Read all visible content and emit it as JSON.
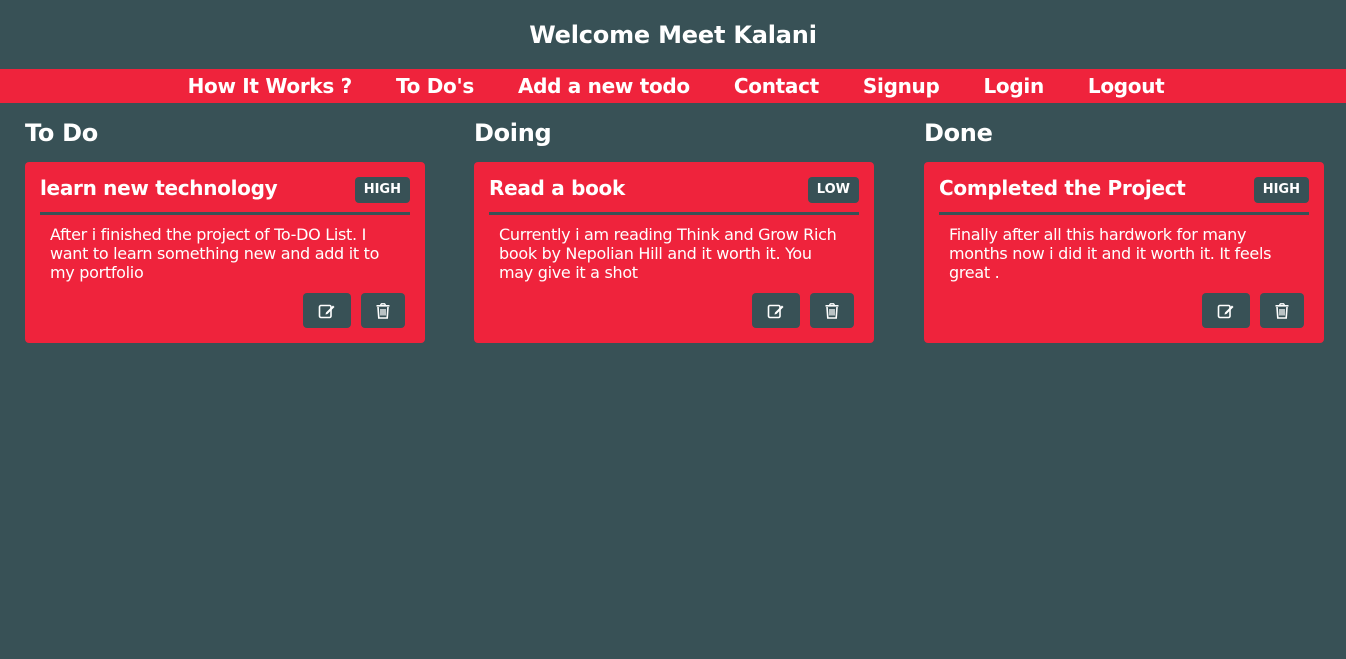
{
  "header": {
    "title": "Welcome Meet Kalani"
  },
  "nav": {
    "items": [
      "How It Works ?",
      "To Do's",
      "Add a new todo",
      "Contact",
      "Signup",
      "Login",
      "Logout"
    ]
  },
  "columns": [
    {
      "title": "To Do",
      "card": {
        "title": "learn new technology",
        "priority": "HIGH",
        "body": "After i finished the project of To-DO List. I want to learn something new and add it to my portfolio",
        "edit_icon": "edit-icon",
        "delete_icon": "trash-icon"
      }
    },
    {
      "title": "Doing",
      "card": {
        "title": "Read a book",
        "priority": "LOW",
        "body": "Currently i am reading Think and Grow Rich book by Nepolian Hill and it worth it. You may give it a shot",
        "edit_icon": "edit-icon",
        "delete_icon": "trash-icon"
      }
    },
    {
      "title": "Done",
      "card": {
        "title": "Completed the Project",
        "priority": "HIGH",
        "body": "Finally after all this hardwork for many months now i did it and it worth it. It feels great .",
        "edit_icon": "edit-icon",
        "delete_icon": "trash-icon"
      }
    }
  ],
  "colors": {
    "background": "#385156",
    "accent": "#ef233c",
    "text": "#ffffff"
  }
}
